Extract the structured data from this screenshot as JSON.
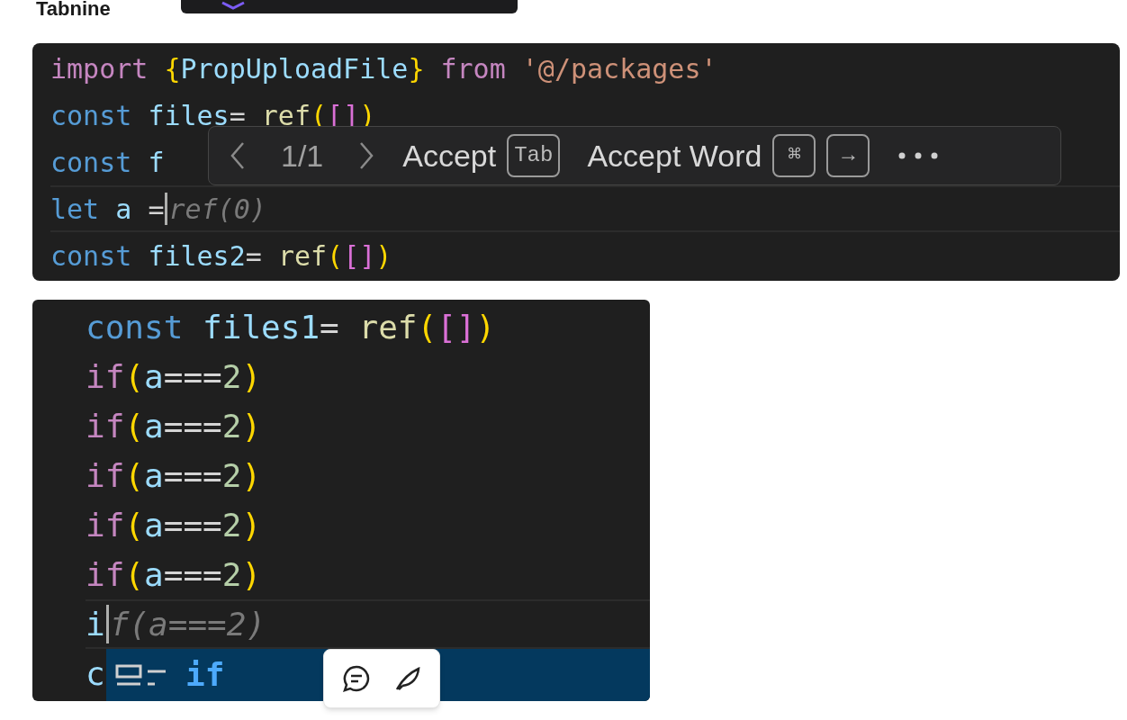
{
  "heading": "Tabnine",
  "editor_top": {
    "lines": [
      {
        "current": false,
        "tokens": [
          {
            "kind": "control",
            "text": "import "
          },
          {
            "kind": "paren",
            "text": "{"
          },
          {
            "kind": "variable",
            "text": "PropUploadFile"
          },
          {
            "kind": "paren",
            "text": "} "
          },
          {
            "kind": "control",
            "text": "from "
          },
          {
            "kind": "string",
            "text": "'@/packages'"
          }
        ]
      },
      {
        "current": false,
        "tokens": [
          {
            "kind": "keyword",
            "text": "const "
          },
          {
            "kind": "variable",
            "text": "files"
          },
          {
            "kind": "operator",
            "text": "= "
          },
          {
            "kind": "function",
            "text": "ref"
          },
          {
            "kind": "paren",
            "text": "("
          },
          {
            "kind": "bracket",
            "text": "[]"
          },
          {
            "kind": "paren",
            "text": ")"
          }
        ]
      },
      {
        "current": false,
        "tokens": [
          {
            "kind": "keyword",
            "text": "const "
          },
          {
            "kind": "variable",
            "text": "f"
          }
        ]
      },
      {
        "current": true,
        "ghost": "ref(0)",
        "tokens": [
          {
            "kind": "keyword",
            "text": "let "
          },
          {
            "kind": "variable",
            "text": "a "
          },
          {
            "kind": "operator",
            "text": "="
          }
        ]
      },
      {
        "current": false,
        "tokens": [
          {
            "kind": "keyword",
            "text": "const "
          },
          {
            "kind": "variable",
            "text": "files2"
          },
          {
            "kind": "operator",
            "text": "= "
          },
          {
            "kind": "function",
            "text": "ref"
          },
          {
            "kind": "paren",
            "text": "("
          },
          {
            "kind": "bracket",
            "text": "[]"
          },
          {
            "kind": "paren",
            "text": ")"
          }
        ]
      }
    ],
    "popup": {
      "counter": "1/1",
      "actions": [
        {
          "label": "Accept",
          "keys": [
            "Tab"
          ]
        },
        {
          "label": "Accept Word",
          "keys": [
            "⌘",
            "→"
          ]
        }
      ]
    }
  },
  "editor_bottom": {
    "lines": [
      {
        "current": false,
        "tokens": [
          {
            "kind": "keyword",
            "text": "const "
          },
          {
            "kind": "variable",
            "text": "files1"
          },
          {
            "kind": "operator",
            "text": "= "
          },
          {
            "kind": "function",
            "text": "ref"
          },
          {
            "kind": "paren",
            "text": "("
          },
          {
            "kind": "bracket",
            "text": "[]"
          },
          {
            "kind": "paren",
            "text": ")"
          }
        ]
      },
      {
        "current": false,
        "tokens": [
          {
            "kind": "control",
            "text": "if"
          },
          {
            "kind": "paren",
            "text": "("
          },
          {
            "kind": "variable",
            "text": "a"
          },
          {
            "kind": "operator",
            "text": "==="
          },
          {
            "kind": "number",
            "text": "2"
          },
          {
            "kind": "paren",
            "text": ")"
          }
        ]
      },
      {
        "current": false,
        "tokens": [
          {
            "kind": "control",
            "text": "if"
          },
          {
            "kind": "paren",
            "text": "("
          },
          {
            "kind": "variable",
            "text": "a"
          },
          {
            "kind": "operator",
            "text": "==="
          },
          {
            "kind": "number",
            "text": "2"
          },
          {
            "kind": "paren",
            "text": ")"
          }
        ]
      },
      {
        "current": false,
        "tokens": [
          {
            "kind": "control",
            "text": "if"
          },
          {
            "kind": "paren",
            "text": "("
          },
          {
            "kind": "variable",
            "text": "a"
          },
          {
            "kind": "operator",
            "text": "==="
          },
          {
            "kind": "number",
            "text": "2"
          },
          {
            "kind": "paren",
            "text": ")"
          }
        ]
      },
      {
        "current": false,
        "tokens": [
          {
            "kind": "control",
            "text": "if"
          },
          {
            "kind": "paren",
            "text": "("
          },
          {
            "kind": "variable",
            "text": "a"
          },
          {
            "kind": "operator",
            "text": "==="
          },
          {
            "kind": "number",
            "text": "2"
          },
          {
            "kind": "paren",
            "text": ")"
          }
        ]
      },
      {
        "current": false,
        "tokens": [
          {
            "kind": "control",
            "text": "if"
          },
          {
            "kind": "paren",
            "text": "("
          },
          {
            "kind": "variable",
            "text": "a"
          },
          {
            "kind": "operator",
            "text": "==="
          },
          {
            "kind": "number",
            "text": "2"
          },
          {
            "kind": "paren",
            "text": ")"
          }
        ]
      },
      {
        "current": true,
        "ghost": "f(a===2)",
        "tokens": [
          {
            "kind": "variable",
            "text": "i"
          }
        ]
      },
      {
        "current": false,
        "tokens": [
          {
            "kind": "variable",
            "text": "c"
          }
        ]
      }
    ],
    "suggestion": {
      "label": "if"
    }
  }
}
